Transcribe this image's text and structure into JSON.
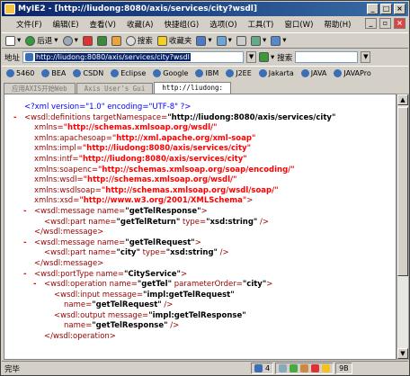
{
  "window": {
    "title": "MyIE2 - [http://liudong:8080/axis/services/city?wsdl]"
  },
  "menubar": [
    "文件(F)",
    "编辑(E)",
    "查看(V)",
    "收藏(A)",
    "快捷组(G)",
    "选项(O)",
    "工具(T)",
    "窗口(W)",
    "帮助(H)"
  ],
  "toolbar": {
    "back_label": "后退",
    "search_label": "搜索",
    "favorites_label": "收藏夹"
  },
  "address": {
    "label": "地址",
    "url": "http://liudong:8080/axis/services/city?wsdl",
    "search_label": "搜索"
  },
  "favorites": [
    "5460",
    "BEA",
    "CSDN",
    "Eclipse",
    "Google",
    "IBM",
    "J2EE",
    "Jakarta",
    "JAVA",
    "JAVAPro"
  ],
  "tabs": [
    "应用AXIS开始Web",
    "Axis User's Gui",
    "http://liudong:"
  ],
  "xml": {
    "pi": "<?xml version=\"1.0\" encoding=\"UTF-8\" ?>",
    "defs_open": "<wsdl:definitions targetNamespace=",
    "tns": "\"http://liudong:8080/axis/services/city\"",
    "xmlns": [
      {
        "attr": "xmlns=",
        "val": "\"http://schemas.xmlsoap.org/wsdl/\""
      },
      {
        "attr": "xmlns:apachesoap=",
        "val": "\"http://xml.apache.org/xml-soap\""
      },
      {
        "attr": "xmlns:impl=",
        "val": "\"http://liudong:8080/axis/services/city\""
      },
      {
        "attr": "xmlns:intf=",
        "val": "\"http://liudong:8080/axis/services/city\""
      },
      {
        "attr": "xmlns:soapenc=",
        "val": "\"http://schemas.xmlsoap.org/soap/encoding/\""
      },
      {
        "attr": "xmlns:wsdl=",
        "val": "\"http://schemas.xmlsoap.org/wsdl/\""
      },
      {
        "attr": "xmlns:wsdlsoap=",
        "val": "\"http://schemas.xmlsoap.org/wsdl/soap/\""
      },
      {
        "attr": "xmlns:xsd=",
        "val": "\"http://www.w3.org/2001/XMLSchema\"",
        "close": ">"
      }
    ],
    "msg1_open": "<wsdl:message name=",
    "msg1_name": "\"getTelResponse\"",
    "msg1_part": "<wsdl:part name=",
    "msg1_part_name": "\"getTelReturn\"",
    "msg1_type_attr": " type=",
    "msg1_type": "\"xsd:string\"",
    "msg_close": "</wsdl:message>",
    "msg2_name": "\"getTelRequest\"",
    "msg2_part_name": "\"city\"",
    "msg2_type": "\"xsd:string\"",
    "port_open": "<wsdl:portType name=",
    "port_name": "\"CityService\"",
    "op_open": "<wsdl:operation name=",
    "op_name": "\"getTel\"",
    "op_order_attr": " parameterOrder=",
    "op_order": "\"city\"",
    "input_open": "<wsdl:input message=",
    "input_msg": "\"impl:getTelRequest\"",
    "input_name_attr": "name=",
    "input_name": "\"getTelRequest\"",
    "output_open": "<wsdl:output message=",
    "output_msg": "\"impl:getTelResponse\"",
    "output_name": "\"getTelResponse\"",
    "op_close": "</wsdl:operation>",
    "gt": ">",
    "slash_gt": " />"
  },
  "status": {
    "text": "完毕",
    "count": "4",
    "zone": "9B"
  },
  "colors": {
    "title_start": "#0a246a",
    "title_end": "#3a6ea5",
    "tag": "#990000",
    "namespace_value": "#ff0000",
    "pi": "#0000ff"
  }
}
